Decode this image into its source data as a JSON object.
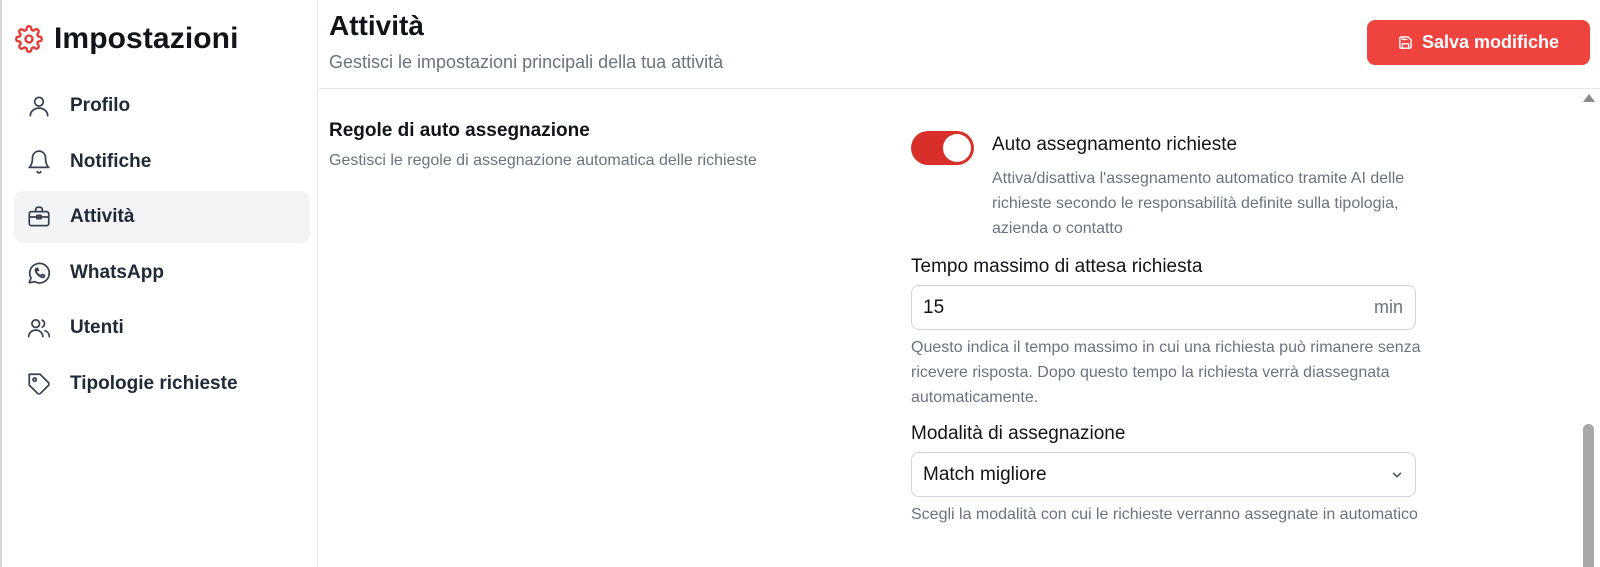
{
  "sidebar": {
    "title": "Impostazioni",
    "title_icon": "gear-icon",
    "items": [
      {
        "label": "Profilo",
        "icon": "user-icon",
        "active": false
      },
      {
        "label": "Notifiche",
        "icon": "bell-icon",
        "active": false
      },
      {
        "label": "Attività",
        "icon": "briefcase-icon",
        "active": true
      },
      {
        "label": "WhatsApp",
        "icon": "whatsapp-icon",
        "active": false
      },
      {
        "label": "Utenti",
        "icon": "users-icon",
        "active": false
      },
      {
        "label": "Tipologie richieste",
        "icon": "tag-icon",
        "active": false
      }
    ]
  },
  "header": {
    "title": "Attività",
    "subtitle": "Gestisci le impostazioni principali della tua attività",
    "save_label": "Salva modifiche",
    "save_icon": "save-icon"
  },
  "section": {
    "title": "Regole di auto assegnazione",
    "description": "Gestisci le regole di assegnazione automatica delle richieste"
  },
  "auto_assign": {
    "label": "Auto assegnamento richieste",
    "enabled": true,
    "description": "Attiva/disattiva l'assegnamento automatico tramite AI delle richieste secondo le responsabilità definite sulla tipologia, azienda o contatto"
  },
  "max_wait": {
    "label": "Tempo massimo di attesa richiesta",
    "value": "15",
    "unit": "min",
    "help": "Questo indica il tempo massimo in cui una richiesta può rimanere senza ricevere risposta. Dopo questo tempo la richiesta verrà diassegnata automaticamente."
  },
  "mode": {
    "label": "Modalità di assegnazione",
    "selected": "Match migliore",
    "help": "Scegli la modalità con cui le richieste verranno assegnate in automatico"
  },
  "colors": {
    "accent": "#ef4340",
    "toggle_on": "#d92f2b",
    "active_nav_bg": "#f3f4f6"
  }
}
